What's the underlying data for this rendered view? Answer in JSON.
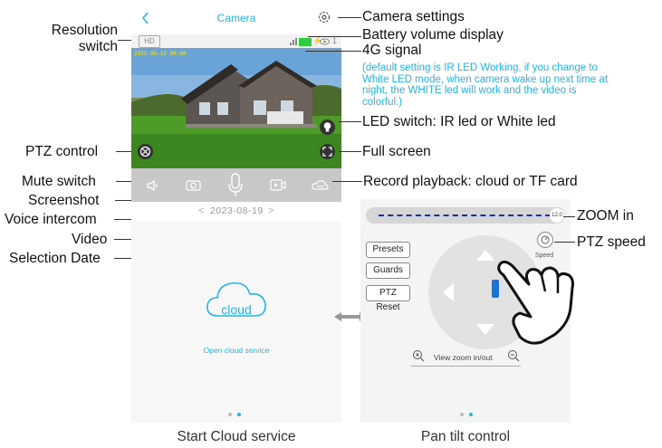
{
  "phone1": {
    "back_icon": "chevron-left-icon",
    "title": "Camera",
    "settings_icon": "gear-icon",
    "hd_label": "HD",
    "timestamp": "2023-08-19 08:08",
    "status_number": "1",
    "date": "2023-08-19",
    "cloud_label": "cloud",
    "open_cloud": "Open cloud service",
    "page_dots": 2,
    "active_dot": 1
  },
  "phone2": {
    "zoom_value": "12.0",
    "presets": "Presets",
    "guards": "Guards",
    "ptz_reset": "PTZ Reset",
    "speed": "Speed",
    "view_zoom": "View zoom in/out"
  },
  "annotations": {
    "resolution_switch": "Resolution\nswitch",
    "ptz_control": "PTZ control",
    "mute_switch": "Mute switch",
    "screenshot": "Screenshot",
    "voice_intercom": "Voice intercom",
    "video": "Video",
    "selection_date": "Selection Date",
    "camera_settings": "Camera settings",
    "battery_volume": "Battery volume display",
    "signal_4g": "4G signal",
    "led_note": "(default setting is IR LED Working, if you change to White LED mode, when camera wake up next time at night, the WHITE led will work and the video is colorful.)",
    "led_switch": "LED switch: IR led or White led",
    "full_screen": "Full screen",
    "record_playback": "Record playback: cloud or TF card",
    "zoom_in": "ZOOM in",
    "ptz_speed": "PTZ speed"
  },
  "captions": {
    "left": "Start Cloud service",
    "right": "Pan tilt control"
  },
  "colors": {
    "accent": "#26b3e6",
    "ptz_dark_blue": "#1a2fa8",
    "battery_green": "#2ecc40"
  }
}
